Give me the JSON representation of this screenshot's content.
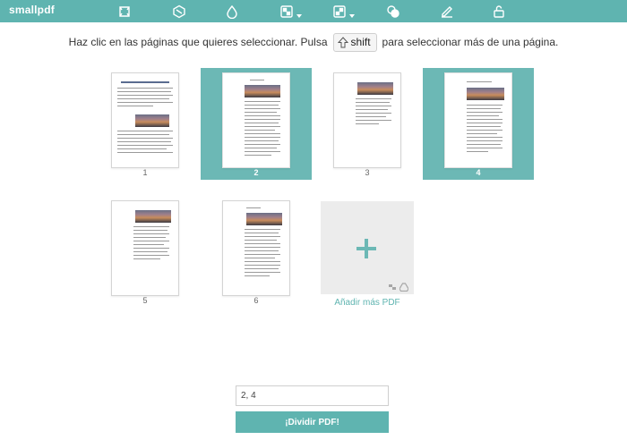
{
  "app": {
    "logo": "smallpdf"
  },
  "toolbar": {
    "tools": [
      {
        "icon": "crop-tool-icon"
      },
      {
        "icon": "compress-tool-icon"
      },
      {
        "icon": "drop-tool-icon"
      },
      {
        "icon": "convert-to-tool-icon"
      },
      {
        "icon": "convert-from-tool-icon"
      },
      {
        "icon": "merge-tool-icon"
      },
      {
        "icon": "sign-tool-icon"
      },
      {
        "icon": "unlock-tool-icon"
      }
    ]
  },
  "instruction": {
    "before": "Haz clic en las páginas que quieres seleccionar. Pulsa",
    "key": "shift",
    "after": "para seleccionar más de una página."
  },
  "pages": [
    {
      "number": "1",
      "selected": false
    },
    {
      "number": "2",
      "selected": true
    },
    {
      "number": "3",
      "selected": false
    },
    {
      "number": "4",
      "selected": true
    },
    {
      "number": "5",
      "selected": false
    },
    {
      "number": "6",
      "selected": false
    }
  ],
  "add_more": {
    "label": "Añadir más PDF"
  },
  "range": {
    "value": "2, 4"
  },
  "split_button": {
    "label": "¡Dividir PDF!"
  },
  "colors": {
    "accent": "#5fb4b0",
    "selected": "#6cb8b5"
  }
}
